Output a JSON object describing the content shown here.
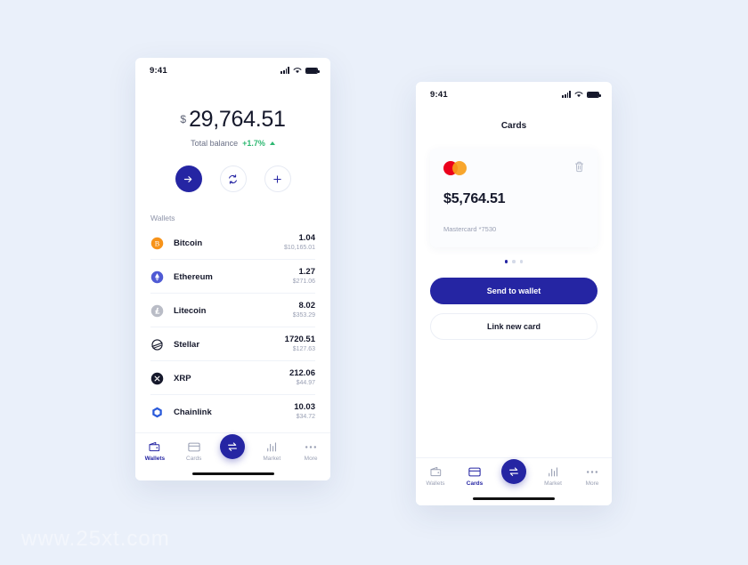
{
  "page": {
    "background_color": "#eaf0fa",
    "accent_color": "#2525a3",
    "watermark": "www.25xt.com"
  },
  "wallets_screen": {
    "status_bar": {
      "time": "9:41",
      "signal_icon": "signal-bars-icon",
      "wifi_icon": "wifi-icon",
      "battery_icon": "battery-icon"
    },
    "balance": {
      "currency_symbol": "$",
      "amount": "29,764.51",
      "label": "Total balance",
      "change": "+1.7%",
      "change_color": "#2eb872"
    },
    "actions": [
      {
        "name": "send-button",
        "icon": "arrow-right-icon"
      },
      {
        "name": "exchange-button",
        "icon": "refresh-icon"
      },
      {
        "name": "add-button",
        "icon": "plus-icon"
      }
    ],
    "section_label": "Wallets",
    "wallets": [
      {
        "name": "Bitcoin",
        "amount": "1.04",
        "usd": "$10,165.01",
        "icon": "bitcoin-icon",
        "color": "#f7931a"
      },
      {
        "name": "Ethereum",
        "amount": "1.27",
        "usd": "$271.06",
        "icon": "ethereum-icon",
        "color": "#4f5ad4"
      },
      {
        "name": "Litecoin",
        "amount": "8.02",
        "usd": "$353.29",
        "icon": "litecoin-icon",
        "color": "#b9bcc6"
      },
      {
        "name": "Stellar",
        "amount": "1720.51",
        "usd": "$127.63",
        "icon": "stellar-icon",
        "color": "#15182b"
      },
      {
        "name": "XRP",
        "amount": "212.06",
        "usd": "$44.97",
        "icon": "xrp-icon",
        "color": "#15182b"
      },
      {
        "name": "Chainlink",
        "amount": "10.03",
        "usd": "$34.72",
        "icon": "chainlink-icon",
        "color": "#2a5ada"
      }
    ],
    "tabs": [
      {
        "label": "Wallets",
        "icon": "wallet-icon",
        "active": true
      },
      {
        "label": "Cards",
        "icon": "card-icon",
        "active": false
      },
      {
        "label": "",
        "icon": "exchange-icon",
        "fab": true
      },
      {
        "label": "Market",
        "icon": "chart-bars-icon",
        "active": false
      },
      {
        "label": "More",
        "icon": "ellipsis-icon",
        "active": false
      }
    ]
  },
  "cards_screen": {
    "status_bar": {
      "time": "9:41",
      "signal_icon": "signal-bars-icon",
      "wifi_icon": "wifi-icon",
      "battery_icon": "battery-icon"
    },
    "title": "Cards",
    "card": {
      "brand_icon": "mastercard-icon",
      "delete_icon": "trash-icon",
      "amount": "$5,764.51",
      "meta": "Mastercard *7530"
    },
    "pagination": {
      "count": 3,
      "active_index": 0
    },
    "buttons": {
      "primary": "Send to wallet",
      "secondary": "Link new card"
    },
    "tabs": [
      {
        "label": "Wallets",
        "icon": "wallet-icon",
        "active": false
      },
      {
        "label": "Cards",
        "icon": "card-icon",
        "active": true
      },
      {
        "label": "",
        "icon": "exchange-icon",
        "fab": true
      },
      {
        "label": "Market",
        "icon": "chart-bars-icon",
        "active": false
      },
      {
        "label": "More",
        "icon": "ellipsis-icon",
        "active": false
      }
    ]
  }
}
